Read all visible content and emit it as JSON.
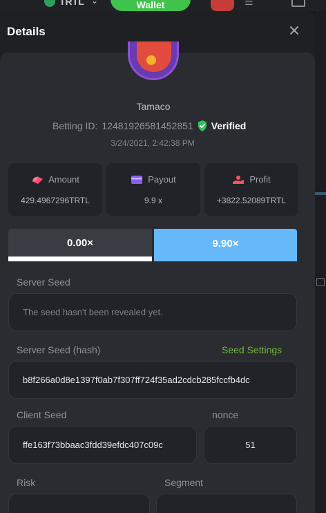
{
  "appbar": {
    "currency": "TRTL",
    "wallet_label": "Wallet"
  },
  "modal": {
    "title": "Details"
  },
  "user": {
    "name": "Tamaco",
    "betting_label": "Betting ID:",
    "betting_id": "12481926581452851",
    "verified_label": "Verified",
    "date": "3/24/2021, 2:42:38 PM"
  },
  "stats": [
    {
      "label": "Amount",
      "value": "429.4967296TRTL",
      "icon": "amount-icon",
      "color": "#ff4f72"
    },
    {
      "label": "Payout",
      "value": "9.9 x",
      "icon": "payout-card-icon",
      "color": "#8b5cf6"
    },
    {
      "label": "Profit",
      "value": "+3822.52089TRTL",
      "icon": "profit-icon",
      "color": "#ff4f62"
    }
  ],
  "multiplier": {
    "left": "0.00×",
    "right": "9.90×",
    "accent": "#66b9f8"
  },
  "server_seed": {
    "label": "Server Seed",
    "placeholder": "The seed hasn't been revealed yet."
  },
  "server_seed_hash": {
    "label": "Server Seed (hash)",
    "value": "b8f266a0d8e1397f0ab7f307ff724f35ad2cdcb285fccfb4dc",
    "settings_link": "Seed Settings",
    "link_color": "#6fb83a"
  },
  "client_seed": {
    "label": "Client Seed",
    "value": "ffe163f73bbaac3fdd39efdc407c09c"
  },
  "nonce": {
    "label": "nonce",
    "value": "51"
  },
  "risk": {
    "label": "Risk"
  },
  "segment": {
    "label": "Segment"
  }
}
